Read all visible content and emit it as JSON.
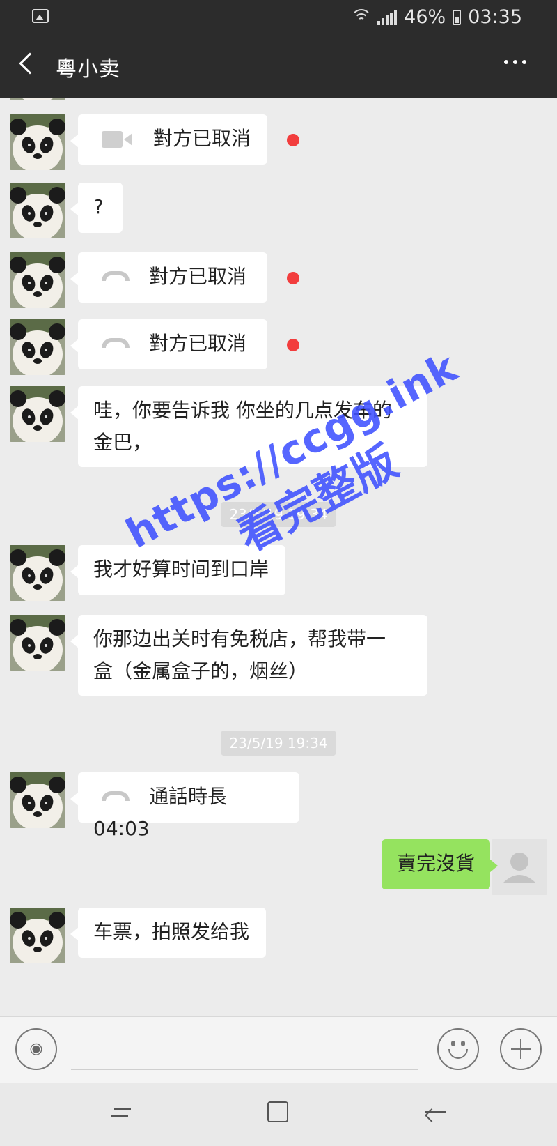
{
  "status_bar": {
    "battery_text": "46%",
    "time": "03:35"
  },
  "header": {
    "title": "粵小卖"
  },
  "messages": [
    {
      "type": "video_call",
      "text": "對方已取消"
    },
    {
      "type": "text",
      "text": "?"
    },
    {
      "type": "voice_call",
      "text": "對方已取消"
    },
    {
      "type": "voice_call",
      "text": "對方已取消"
    },
    {
      "type": "text",
      "lines": [
        "哇，你要告诉我 你坐的几点发车的",
        "金巴，"
      ]
    },
    {
      "type": "timestamp",
      "text": "23/5/19 19:34"
    },
    {
      "type": "text",
      "text": "我才好算时间到口岸"
    },
    {
      "type": "text",
      "lines": [
        "你那边出关时有免税店，帮我带一",
        "盒（金属盒子的，烟丝）"
      ]
    },
    {
      "type": "timestamp",
      "text": "23/5/19 19:34"
    },
    {
      "type": "voice_call",
      "text": "通話時長 04:03"
    },
    {
      "type": "self_text",
      "text": "賣完沒貨"
    },
    {
      "type": "text",
      "text": "车票，拍照发给我"
    }
  ],
  "watermark": {
    "line1": "https://ccgg.ink",
    "line2": "看完整版"
  },
  "colors": {
    "self_bubble": "#95e35f",
    "missed_dot": "#f23d3d",
    "watermark": "#3f51ff"
  }
}
